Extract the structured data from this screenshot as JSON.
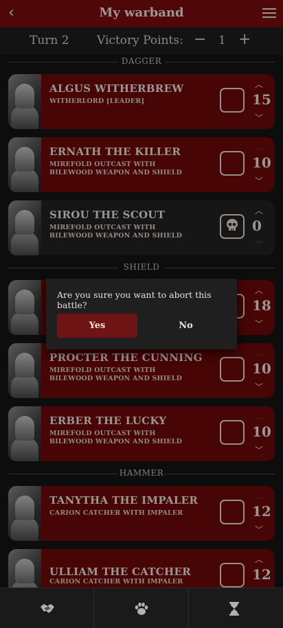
{
  "header": {
    "title": "My warband",
    "back_icon": "chevron-left-icon",
    "menu_icon": "hamburger-menu-icon"
  },
  "turnbar": {
    "turn": "Turn 2",
    "vp_label": "Victory Points:",
    "vp_value": "1",
    "minus": "−",
    "plus": "+"
  },
  "sections": {
    "dagger": "DAGGER",
    "shield": "SHIELD",
    "hammer": "HAMMER"
  },
  "fighters": [
    {
      "name": "ALGUS WITHERBREW",
      "sub": "WITHERLORD [LEADER]",
      "value": "15",
      "state": "active"
    },
    {
      "name": "ERNATH THE KILLER",
      "sub": "MIREFOLD OUTCAST WITH BILEWOOD WEAPON AND SHIELD",
      "value": "10",
      "state": "active"
    },
    {
      "name": "SIROU THE SCOUT",
      "sub": "MIREFOLD OUTCAST WITH BILEWOOD WEAPON AND SHIELD",
      "value": "0",
      "state": "dead"
    },
    {
      "name": "",
      "sub": "",
      "value": "18",
      "state": "active"
    },
    {
      "name": "PROCTER THE CUNNING",
      "sub": "MIREFOLD OUTCAST WITH BILEWOOD WEAPON AND SHIELD",
      "value": "10",
      "state": "active"
    },
    {
      "name": "ERBER THE LUCKY",
      "sub": "MIREFOLD OUTCAST WITH BILEWOOD WEAPON AND SHIELD",
      "value": "10",
      "state": "active"
    },
    {
      "name": "TANYTHA THE IMPALER",
      "sub": "CARION CATCHER WITH IMPALER",
      "value": "12",
      "state": "active"
    },
    {
      "name": "ULLIAM THE CATCHER",
      "sub": "CARION CATCHER WITH IMPALER",
      "value": "12",
      "state": "active"
    }
  ],
  "dialog": {
    "message": "Are you sure you want to abort this battle?",
    "yes": "Yes",
    "no": "No"
  },
  "bottom_tabs": [
    {
      "icon": "handshake-icon"
    },
    {
      "icon": "paw-icon"
    },
    {
      "icon": "hourglass-icon"
    }
  ],
  "colors": {
    "accent": "#7a0c0c",
    "card": "#6e0808",
    "dark_card": "#232323",
    "background": "#141414"
  }
}
